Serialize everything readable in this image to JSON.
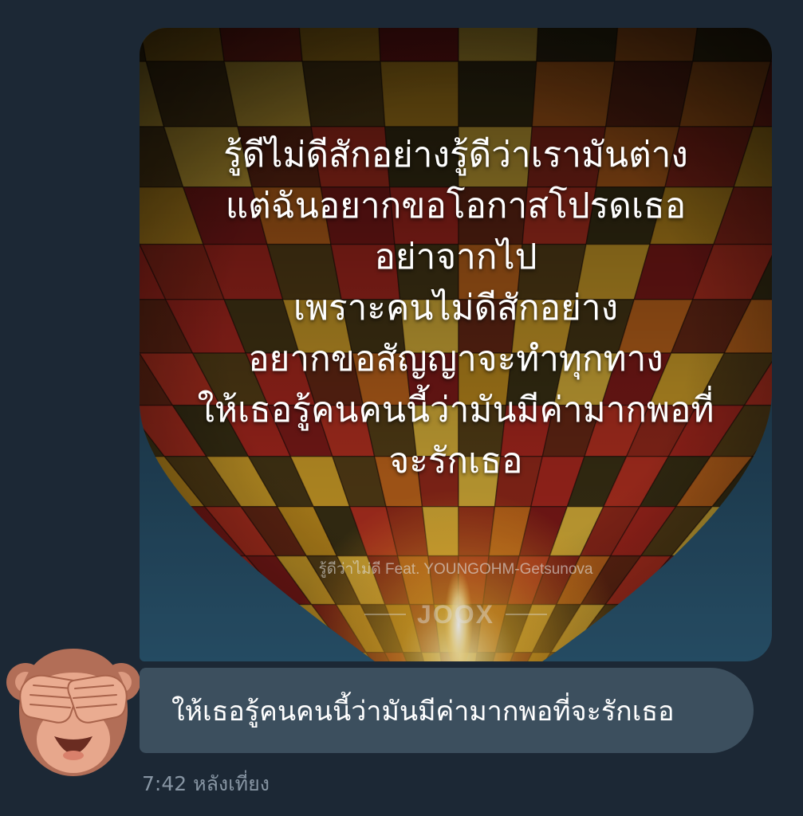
{
  "chat": {
    "avatar": {
      "icon": "see-no-evil-monkey-icon"
    },
    "image_message": {
      "lyrics": [
        "รู้ดีไม่ดีสักอย่างรู้ดีว่าเรามันต่าง",
        "แต่ฉันอยากขอโอกาสโปรดเธอ",
        "อย่าจากไป",
        "เพราะคนไม่ดีสักอย่าง",
        "อยากขอสัญญาจะทำทุกทาง",
        "ให้เธอรู้คนคนนี้ว่ามันมีค่ามากพอที่",
        "จะรักเธอ"
      ],
      "caption": "รู้ดีว่าไม่ดี Feat. YOUNGOHM-Getsunova",
      "logo": "JOOX"
    },
    "text_message": "ให้เธอรู้คนคนนี้ว่ามันมีค่ามากพอที่จะรักเธอ",
    "timestamp": "7:42 หลังเที่ยง"
  },
  "colors": {
    "background": "#1c2835",
    "bubble": "#3c4f5e",
    "message_text": "#ffffff",
    "timestamp_text": "#8795a3"
  }
}
